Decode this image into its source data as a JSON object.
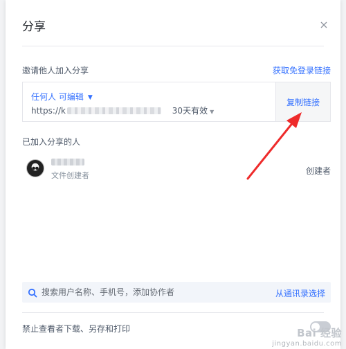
{
  "dialog": {
    "title": "分享",
    "close_icon": "close-icon"
  },
  "invite": {
    "section_label": "邀请他人加入分享",
    "quick_login_link": "获取免登录链接",
    "permission_label": "任何人 可编辑",
    "url_prefix": "https://k",
    "validity": "30天有效",
    "copy_link_button": "复制链接"
  },
  "members": {
    "section_label": "已加入分享的人",
    "items": [
      {
        "subtitle": "文件创建者",
        "role": "创建者"
      }
    ]
  },
  "search": {
    "placeholder": "搜索用户名称、手机号，添加协作者",
    "contacts_link": "从通讯录选择"
  },
  "restrict": {
    "label": "禁止查看者下载、另存和打印",
    "enabled": false
  },
  "watermark": {
    "brand": "Bai 经验",
    "url": "jingyan.baidu.com"
  },
  "colors": {
    "accent": "#3370ff",
    "annotation_arrow": "#ee2b2b"
  }
}
